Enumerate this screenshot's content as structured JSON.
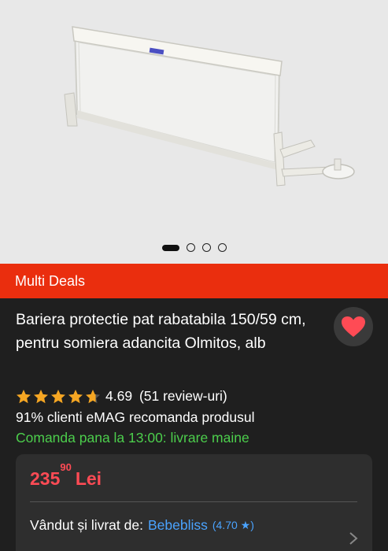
{
  "gallery": {
    "image_count": 4,
    "active_index": 0,
    "brand_label": "Olmitos"
  },
  "banner": {
    "label": "Multi Deals"
  },
  "product": {
    "title": "Bariera protectie pat rabatabila 150/59 cm, pentru somiera adancita Olmitos, alb",
    "rating_value": "4.69",
    "rating_stars": 4.69,
    "review_count": "(51 review-uri)",
    "recommend": "91% clienti eMAG recomanda produsul",
    "delivery": "Comanda pana la 13:00: livrare maine"
  },
  "offer": {
    "price_int": "235",
    "price_dec": "90",
    "currency": "Lei",
    "seller_label": "Vândut și livrat de:",
    "seller_name": "Bebebliss",
    "seller_rating": "(4.70 ★)"
  },
  "colors": {
    "banner": "#ea2e0e",
    "price": "#ff4b55",
    "delivery": "#4cce4c",
    "seller": "#4aa3ff",
    "heart": "#ff4b55",
    "star": "#f5a623"
  }
}
